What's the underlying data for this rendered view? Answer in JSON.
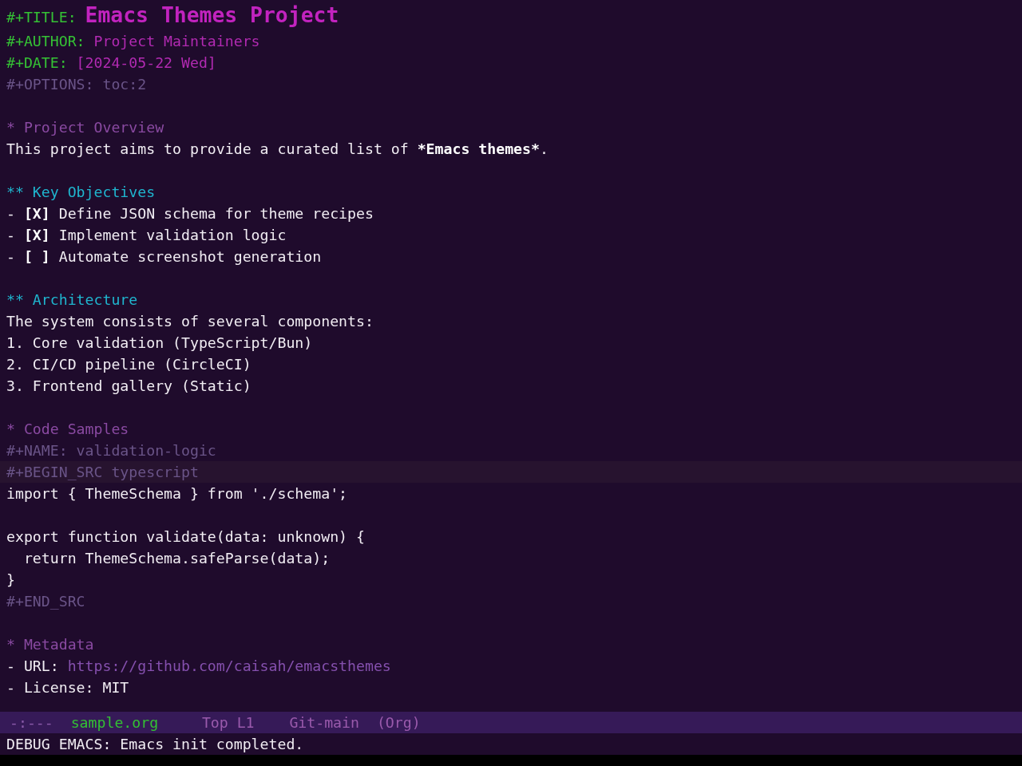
{
  "header": [
    {
      "kind": "title",
      "keyword": "#+TITLE:",
      "value": "Emacs Themes Project"
    },
    {
      "kind": "author",
      "keyword": "#+AUTHOR:",
      "value": "Project Maintainers"
    },
    {
      "kind": "date",
      "keyword": "#+DATE:",
      "value": "[2024-05-22 Wed]"
    },
    {
      "kind": "option",
      "keyword": "#+OPTIONS:",
      "value": "toc:2"
    }
  ],
  "sections": [
    {
      "marker": "*",
      "title": "Project Overview",
      "body": [
        {
          "kind": "paragraph",
          "parts": [
            {
              "text": "This project aims to provide a curated list of ",
              "bold": false
            },
            {
              "text": "*Emacs themes*",
              "bold": true
            },
            {
              "text": ".",
              "bold": false
            }
          ]
        }
      ],
      "children": [
        {
          "marker": "**",
          "title": "Key Objectives",
          "body": [
            {
              "kind": "task",
              "bullet": "-",
              "box": "[X]",
              "text": "Define JSON schema for theme recipes"
            },
            {
              "kind": "task",
              "bullet": "-",
              "box": "[X]",
              "text": "Implement validation logic"
            },
            {
              "kind": "task",
              "bullet": "-",
              "box": "[ ]",
              "text": "Automate screenshot generation"
            }
          ]
        },
        {
          "marker": "**",
          "title": "Architecture",
          "body": [
            {
              "kind": "paragraph",
              "parts": [
                {
                  "text": "The system consists of several components:",
                  "bold": false
                }
              ]
            },
            {
              "kind": "numbered",
              "marker": "1.",
              "text": "Core validation (TypeScript/Bun)"
            },
            {
              "kind": "numbered",
              "marker": "2.",
              "text": "CI/CD pipeline (CircleCI)"
            },
            {
              "kind": "numbered",
              "marker": "3.",
              "text": "Frontend gallery (Static)"
            }
          ]
        }
      ]
    },
    {
      "marker": "*",
      "title": "Code Samples",
      "body": [
        {
          "kind": "name",
          "keyword": "#+NAME:",
          "value": "validation-logic"
        },
        {
          "kind": "src",
          "begin": "#+BEGIN_SRC typescript",
          "code": "import { ThemeSchema } from './schema';\n\nexport function validate(data: unknown) {\n  return ThemeSchema.safeParse(data);\n}",
          "end": "#+END_SRC"
        }
      ]
    },
    {
      "marker": "*",
      "title": "Metadata",
      "body": [
        {
          "kind": "link",
          "bullet": "-",
          "label": "URL:",
          "url": "https://github.com/caisah/emacsthemes"
        },
        {
          "kind": "item",
          "bullet": "-",
          "text": "License: MIT"
        }
      ]
    }
  ],
  "mode_line": [
    {
      "kind": "status",
      "text": "-:---"
    },
    {
      "kind": "buffer",
      "text": "sample.org"
    },
    {
      "kind": "position",
      "text": "Top L1"
    },
    {
      "kind": "vc",
      "text": "Git-main"
    },
    {
      "kind": "mode",
      "text": "(Org)"
    }
  ],
  "echo_area": {
    "message": "DEBUG EMACS: Emacs init completed."
  }
}
